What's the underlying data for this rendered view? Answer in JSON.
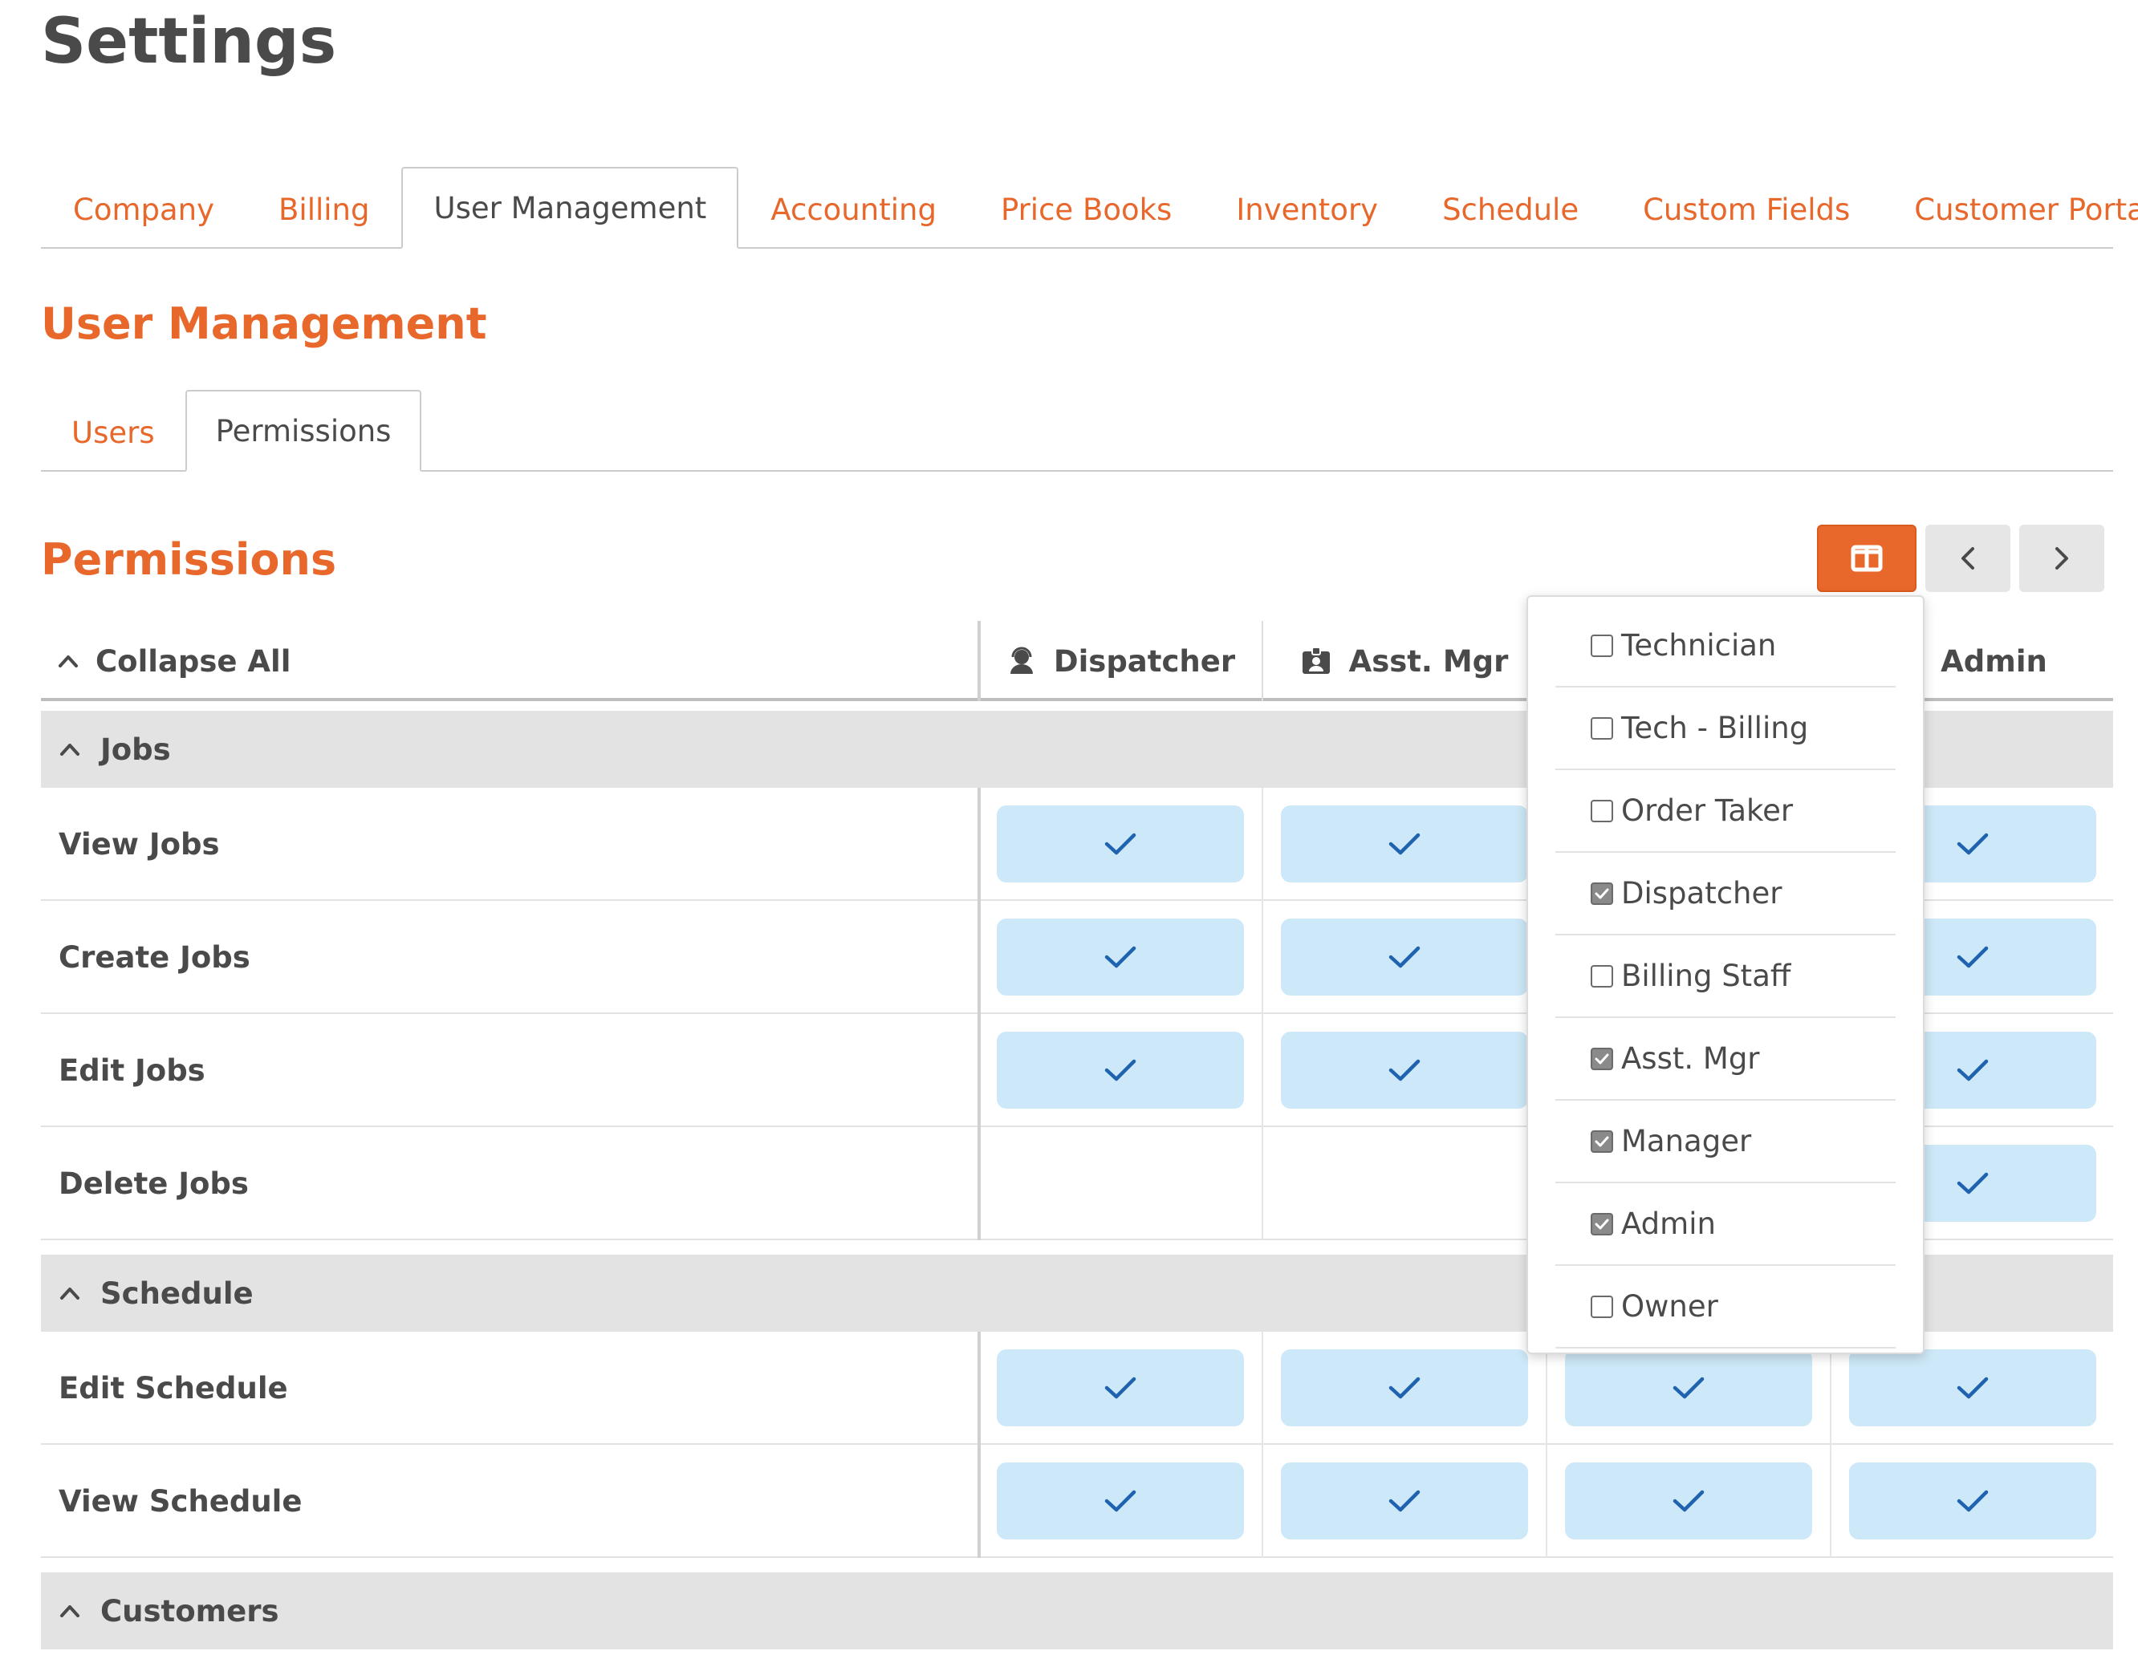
{
  "page": {
    "title": "Settings"
  },
  "main_tabs": [
    {
      "label": "Company",
      "active": false
    },
    {
      "label": "Billing",
      "active": false
    },
    {
      "label": "User Management",
      "active": true
    },
    {
      "label": "Accounting",
      "active": false
    },
    {
      "label": "Price Books",
      "active": false
    },
    {
      "label": "Inventory",
      "active": false
    },
    {
      "label": "Schedule",
      "active": false
    },
    {
      "label": "Custom Fields",
      "active": false
    },
    {
      "label": "Customer Portal",
      "active": false
    }
  ],
  "section": {
    "title": "User Management"
  },
  "sub_tabs": [
    {
      "label": "Users",
      "active": false
    },
    {
      "label": "Permissions",
      "active": true
    }
  ],
  "permissions": {
    "title": "Permissions",
    "collapse_all": "Collapse All",
    "toolbar_icons": [
      "columns-icon",
      "chevron-left-icon",
      "chevron-right-icon"
    ],
    "columns": [
      {
        "label": "Dispatcher",
        "icon": "headset-user-icon"
      },
      {
        "label": "Asst. Mgr",
        "icon": "id-badge-icon"
      },
      {
        "label": "",
        "icon": ""
      },
      {
        "label": "Admin",
        "icon": "admin-icon"
      }
    ],
    "groups": [
      {
        "name": "Jobs",
        "rows": [
          {
            "label": "View Jobs",
            "checks": [
              true,
              true,
              true,
              true
            ]
          },
          {
            "label": "Create Jobs",
            "checks": [
              true,
              true,
              true,
              true
            ]
          },
          {
            "label": "Edit Jobs",
            "checks": [
              true,
              true,
              true,
              true
            ]
          },
          {
            "label": "Delete Jobs",
            "checks": [
              false,
              false,
              false,
              true
            ]
          }
        ]
      },
      {
        "name": "Schedule",
        "rows": [
          {
            "label": "Edit Schedule",
            "checks": [
              true,
              true,
              true,
              true
            ]
          },
          {
            "label": "View Schedule",
            "checks": [
              true,
              true,
              true,
              true
            ]
          }
        ]
      },
      {
        "name": "Customers",
        "rows": []
      }
    ]
  },
  "column_picker": {
    "items": [
      {
        "label": "Technician",
        "checked": false
      },
      {
        "label": "Tech - Billing",
        "checked": false
      },
      {
        "label": "Order Taker",
        "checked": false
      },
      {
        "label": "Dispatcher",
        "checked": true
      },
      {
        "label": "Billing Staff",
        "checked": false
      },
      {
        "label": "Asst. Mgr",
        "checked": true
      },
      {
        "label": "Manager",
        "checked": true
      },
      {
        "label": "Admin",
        "checked": true
      },
      {
        "label": "Owner",
        "checked": false
      }
    ]
  },
  "colors": {
    "accent": "#e8672b",
    "check_bg": "#cde8f8",
    "check_mark": "#1f63b0",
    "group_bg": "#e3e3e3",
    "text": "#4a4a4a"
  }
}
